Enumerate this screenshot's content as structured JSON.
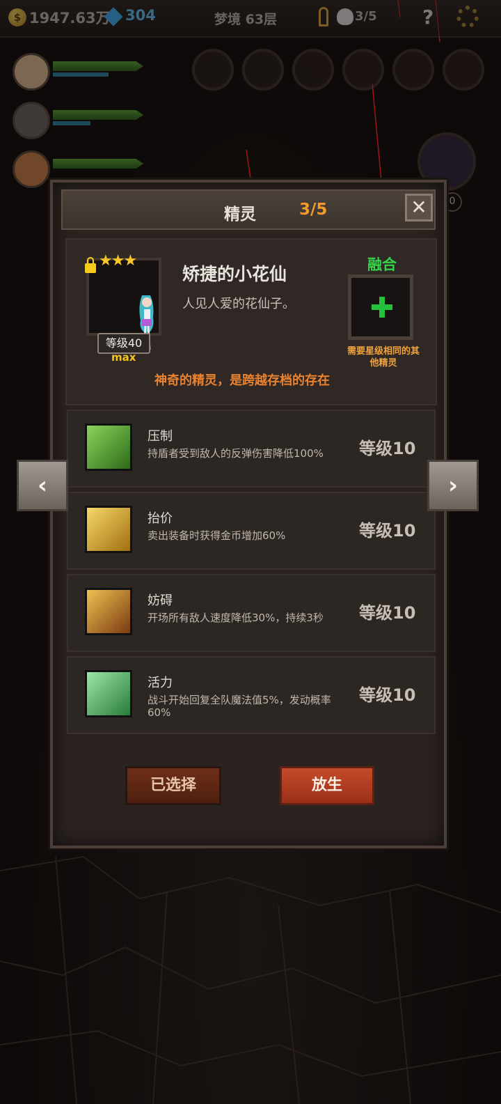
{
  "topbar": {
    "gold": "1947.63万",
    "gems": "304",
    "floor": "梦境 63层",
    "skulls": "3/5",
    "help": "?"
  },
  "side_badge": "0",
  "modal": {
    "title": "精灵",
    "count": "3/5",
    "close": "✕"
  },
  "pet": {
    "name": "矫捷的小花仙",
    "desc": "人见人爱的花仙子。",
    "stars": "★★★",
    "level": "等级40",
    "max": "max",
    "fuse_label": "融合",
    "fuse_note": "需要星级相同的其他精灵",
    "tagline": "神奇的精灵，是跨越存档的存在"
  },
  "skills": [
    {
      "name": "压制",
      "desc": "持盾者受到敌人的反弹伤害降低100%",
      "level": "等级10",
      "color": "#5aa83a"
    },
    {
      "name": "抬价",
      "desc": "卖出装备时获得金币增加60%",
      "level": "等级10",
      "color": "#e0b53a"
    },
    {
      "name": "妨碍",
      "desc": "开场所有敌人速度降低30%，持续3秒",
      "level": "等级10",
      "color": "#c98b3a"
    },
    {
      "name": "活力",
      "desc": "战斗开始回复全队魔法值5%，发动概率60%",
      "level": "等级10",
      "color": "#4fb06a"
    }
  ],
  "buttons": {
    "selected": "已选择",
    "release": "放生"
  },
  "nav": {
    "prev": "‹",
    "next": "›"
  }
}
